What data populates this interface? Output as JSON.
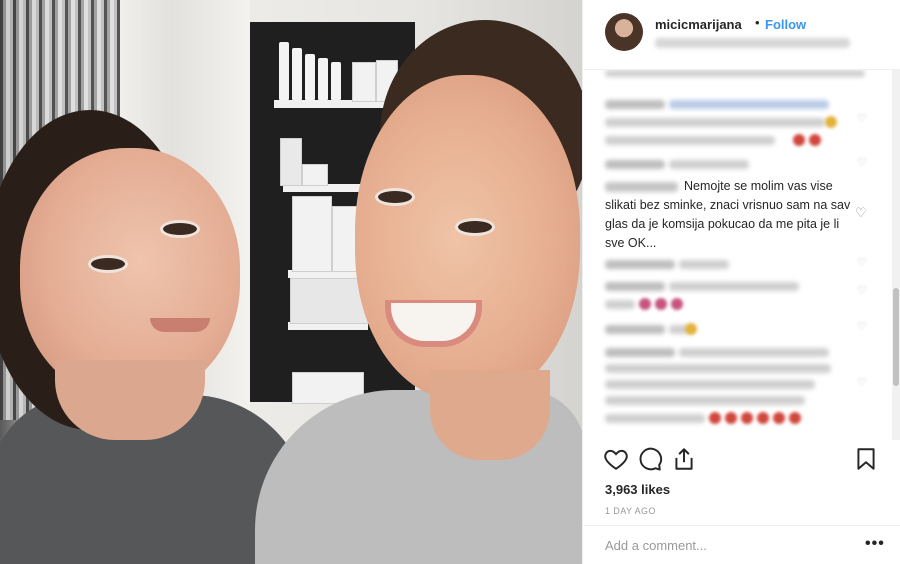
{
  "header": {
    "username": "micicmarijana",
    "separator": "•",
    "follow_label": "Follow"
  },
  "comments": {
    "visible_comment": "Nemojte se molim vas vise slikati bez sminke, znaci vrisnuo sam na sav glas da je komsija pokucao da me pita je li sve OK..."
  },
  "icons": {
    "like": "heart-icon",
    "comment": "comment-icon",
    "share": "share-icon",
    "save": "bookmark-icon",
    "more": "more-options-icon"
  },
  "post": {
    "likes": "3,963 likes",
    "date": "1 DAY AGO"
  },
  "add_comment": {
    "placeholder": "Add a comment...",
    "more_label": "•••"
  },
  "colors": {
    "follow": "#3897f0",
    "text": "#262626",
    "muted": "#999999",
    "divider": "#efefef"
  }
}
